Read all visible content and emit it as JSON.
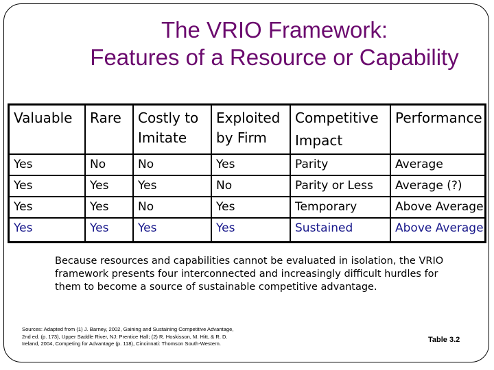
{
  "title": {
    "line1": "The VRIO Framework:",
    "line2": "Features of a Resource or Capability"
  },
  "table": {
    "headers": [
      {
        "line1": "Valuable",
        "line2": ""
      },
      {
        "line1": "Rare",
        "line2": ""
      },
      {
        "line1": "Costly to",
        "line2": "Imitate"
      },
      {
        "line1": "Exploited",
        "line2": "by Firm"
      },
      {
        "line1": "Competitive",
        "line2": "Impact"
      },
      {
        "line1": "Performance",
        "line2": ""
      }
    ],
    "rows": [
      [
        "Yes",
        "No",
        "No",
        "Yes",
        "Parity",
        "Average"
      ],
      [
        "Yes",
        "Yes",
        "Yes",
        "No",
        "Parity or Less",
        "Average (?)"
      ],
      [
        "Yes",
        "Yes",
        "No",
        "Yes",
        "Temporary",
        "Above Average"
      ],
      [
        "Yes",
        "Yes",
        "Yes",
        "Yes",
        "Sustained",
        "Above Average"
      ]
    ],
    "highlight_row_color": "#1a1a8c"
  },
  "body_text": "Because resources and capabilities cannot be evaluated in isolation, the VRIO framework presents four interconnected and increasingly difficult hurdles for them to become a source of sustainable competitive advantage.",
  "sources": "Sources: Adapted from (1) J. Barney, 2002, Gaining and Sustaining Competitive Advantage, 2nd ed. (p. 173), Upper Saddle River, NJ: Prentice Hall; (2) R. Hoskisson, M. Hitt, & R. D. Ireland, 2004, Competing for Advantage (p. 118), Cincinnati: Thomson South-Western.",
  "table_label": "Table 3.2",
  "colors": {
    "title": "#6b0a6e",
    "text": "#000000",
    "highlight": "#1a1a8c"
  }
}
